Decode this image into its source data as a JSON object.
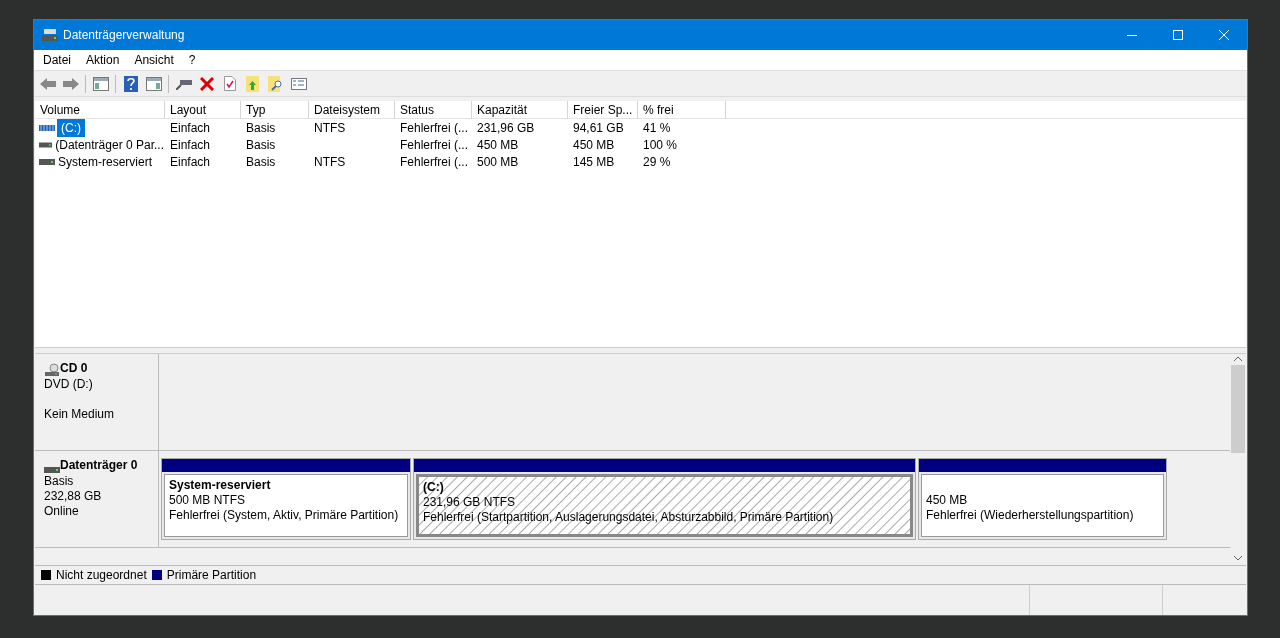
{
  "window": {
    "title": "Datenträgerverwaltung"
  },
  "menu": [
    "Datei",
    "Aktion",
    "Ansicht",
    "?"
  ],
  "volume_table": {
    "columns": [
      "Volume",
      "Layout",
      "Typ",
      "Dateisystem",
      "Status",
      "Kapazität",
      "Freier Sp...",
      "% frei"
    ],
    "rows": [
      {
        "kind": "striped",
        "selected": true,
        "cells": [
          "(C:)",
          "Einfach",
          "Basis",
          "NTFS",
          "Fehlerfrei (...",
          "231,96 GB",
          "94,61 GB",
          "41 %"
        ]
      },
      {
        "kind": "plain",
        "selected": false,
        "cells": [
          "(Datenträger 0 Par...",
          "Einfach",
          "Basis",
          "",
          "Fehlerfrei (...",
          "450 MB",
          "450 MB",
          "100 %"
        ]
      },
      {
        "kind": "plain",
        "selected": false,
        "cells": [
          "System-reserviert",
          "Einfach",
          "Basis",
          "NTFS",
          "Fehlerfrei (...",
          "500 MB",
          "145 MB",
          "29 %"
        ]
      }
    ]
  },
  "disks": [
    {
      "kind": "cd",
      "name": "CD 0",
      "lines": [
        "DVD (D:)",
        "Kein Medium"
      ]
    },
    {
      "kind": "disk",
      "name": "Datenträger 0",
      "lines": [
        "Basis",
        "232,88 GB",
        "Online"
      ],
      "partitions": [
        {
          "name": "System-reserviert",
          "size": "500 MB NTFS",
          "status": "Fehlerfrei (System, Aktiv, Primäre Partition)",
          "selected": false
        },
        {
          "name": "(C:)",
          "size": "231,96 GB NTFS",
          "status": "Fehlerfrei (Startpartition, Auslagerungsdatei, Absturzabbild, Primäre Partition)",
          "selected": true
        },
        {
          "size": "450 MB",
          "status": "Fehlerfrei (Wiederherstellungspartition)",
          "selected": false
        }
      ]
    }
  ],
  "legend": [
    {
      "label": "Nicht zugeordnet",
      "color": "#000000"
    },
    {
      "label": "Primäre Partition",
      "color": "#000080"
    }
  ]
}
